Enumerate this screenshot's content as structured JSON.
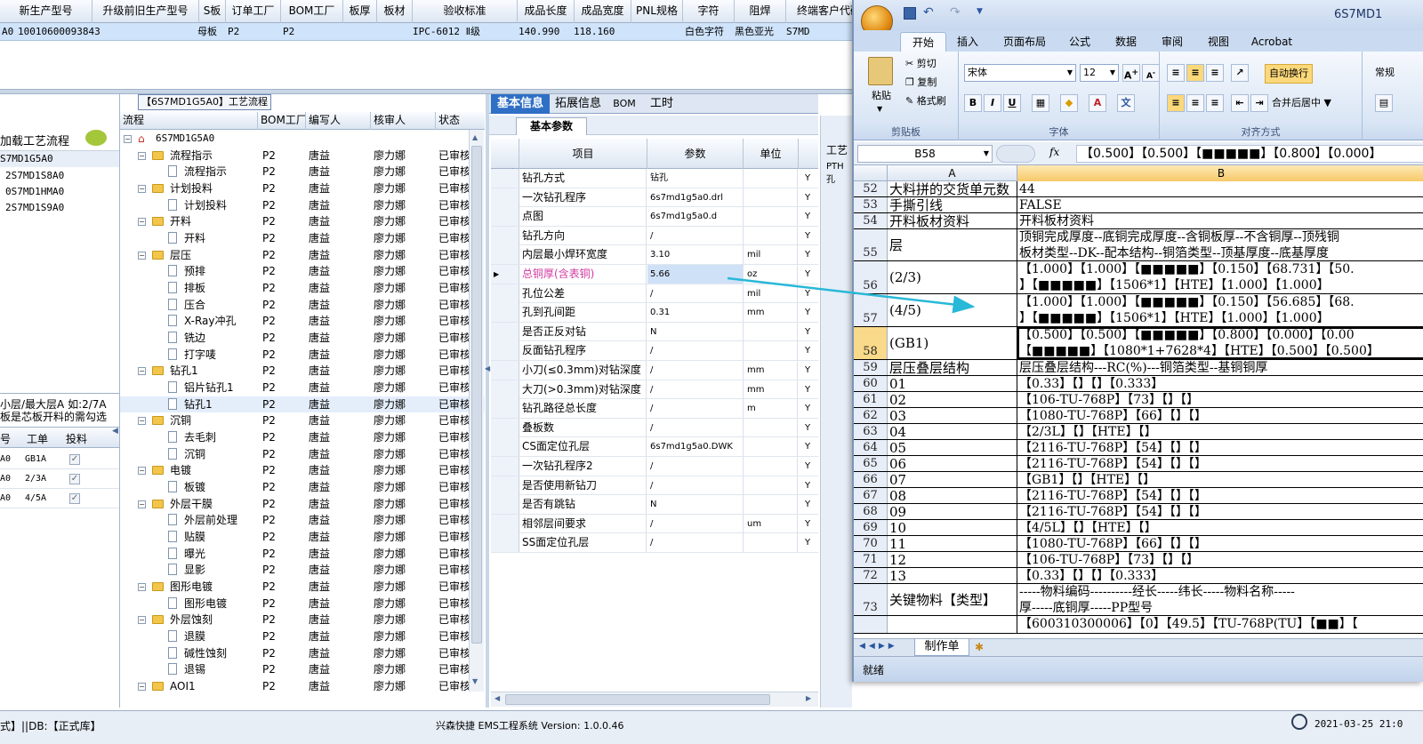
{
  "top_grid": {
    "headers": [
      "新生产型号",
      "升级前旧生产型号",
      "S板",
      "订单工厂",
      "BOM工厂",
      "板厚",
      "板材",
      "验收标准",
      "成品长度",
      "成品宽度",
      "PNL规格",
      "字符",
      "阻焊",
      "终端客户代码"
    ],
    "row": [
      "A0",
      "10010600093843",
      "",
      "母板",
      "P2",
      "P2",
      "",
      "IPC-6012 Ⅱ级",
      "140.990",
      "118.160",
      "",
      "白色字符",
      "黑色亚光",
      "S7MD"
    ]
  },
  "left_panel": {
    "title": "加载工艺流程",
    "items": [
      "S7MD1G5A0",
      "2S7MD1S8A0",
      "0S7MD1HMA0",
      "2S7MD1S9A0"
    ],
    "note_line1": "小层/最大层A 如:2/7A",
    "note_line2": "板是芯板开料的需勾选",
    "mini_headers": [
      "号",
      "工单",
      "投料"
    ],
    "mini_rows": [
      {
        "id": "A0",
        "order": "GB1A"
      },
      {
        "id": "A0",
        "order": "2/3A"
      },
      {
        "id": "A0",
        "order": "4/5A"
      }
    ]
  },
  "flow_panel": {
    "title": "【6S7MD1G5A0】工艺流程",
    "headers": [
      "流程",
      "BOM工厂",
      "编写人",
      "核审人",
      "状态"
    ],
    "root": "6S7MD1G5A0",
    "rows": [
      {
        "t": "f",
        "n": "流程指示"
      },
      {
        "t": "d",
        "n": "流程指示"
      },
      {
        "t": "f",
        "n": "计划投料"
      },
      {
        "t": "d",
        "n": "计划投料"
      },
      {
        "t": "f",
        "n": "开料"
      },
      {
        "t": "d",
        "n": "开料"
      },
      {
        "t": "f",
        "n": "层压"
      },
      {
        "t": "d",
        "n": "预排"
      },
      {
        "t": "d",
        "n": "排板"
      },
      {
        "t": "d",
        "n": "压合"
      },
      {
        "t": "d",
        "n": "X-Ray冲孔"
      },
      {
        "t": "d",
        "n": "铣边"
      },
      {
        "t": "d",
        "n": "打字唛"
      },
      {
        "t": "f",
        "n": "钻孔1"
      },
      {
        "t": "d",
        "n": "铝片钻孔1"
      },
      {
        "t": "d",
        "n": "钻孔1"
      },
      {
        "t": "f",
        "n": "沉铜"
      },
      {
        "t": "d",
        "n": "去毛刺"
      },
      {
        "t": "d",
        "n": "沉铜"
      },
      {
        "t": "f",
        "n": "电镀"
      },
      {
        "t": "d",
        "n": "板镀"
      },
      {
        "t": "f",
        "n": "外层干膜"
      },
      {
        "t": "d",
        "n": "外层前处理"
      },
      {
        "t": "d",
        "n": "贴膜"
      },
      {
        "t": "d",
        "n": "曝光"
      },
      {
        "t": "d",
        "n": "显影"
      },
      {
        "t": "f",
        "n": "图形电镀"
      },
      {
        "t": "d",
        "n": "图形电镀"
      },
      {
        "t": "f",
        "n": "外层蚀刻"
      },
      {
        "t": "d",
        "n": "退膜"
      },
      {
        "t": "d",
        "n": "碱性蚀刻"
      },
      {
        "t": "d",
        "n": "退锡"
      },
      {
        "t": "f",
        "n": "AOI1"
      }
    ],
    "bom": "P2",
    "writer": "唐益",
    "auditor": "廖力娜",
    "status": "已审核"
  },
  "params_panel": {
    "tabs": [
      "基本信息",
      "拓展信息",
      "BOM",
      "工时"
    ],
    "subtab": "基本参数",
    "headers": [
      "项目",
      "参数",
      "单位"
    ],
    "rows": [
      [
        "钻孔方式",
        "钻孔",
        "",
        "Y"
      ],
      [
        "一次钻孔程序",
        "6s7md1g5a0.drl",
        "",
        "Y"
      ],
      [
        "点图",
        "6s7md1g5a0.d",
        "",
        "Y"
      ],
      [
        "钻孔方向",
        "/",
        "",
        "Y"
      ],
      [
        "内层最小焊环宽度",
        "3.10",
        "mil",
        "Y"
      ],
      [
        "总铜厚(含表铜)",
        "5.66",
        "oz",
        "Y"
      ],
      [
        "孔位公差",
        "/",
        "mil",
        "Y"
      ],
      [
        "孔到孔间距",
        "0.31",
        "mm",
        "Y"
      ],
      [
        "是否正反对钻",
        "N",
        "",
        "Y"
      ],
      [
        "反面钻孔程序",
        "/",
        "",
        "Y"
      ],
      [
        "小刀(≤0.3mm)对钻深度",
        "/",
        "mm",
        "Y"
      ],
      [
        "大刀(>0.3mm)对钻深度",
        "/",
        "mm",
        "Y"
      ],
      [
        "钻孔路径总长度",
        "/",
        "m",
        "Y"
      ],
      [
        "叠板数",
        "/",
        "",
        "Y"
      ],
      [
        "CS面定位孔层",
        "6s7md1g5a0.DWK",
        "",
        "Y"
      ],
      [
        "一次钻孔程序2",
        "/",
        "",
        "Y"
      ],
      [
        "是否使用新钻刀",
        "/",
        "",
        "Y"
      ],
      [
        "是否有跳钻",
        "N",
        "",
        "Y"
      ],
      [
        "相邻层间要求",
        "/",
        "um",
        "Y"
      ],
      [
        "SS面定位孔层",
        "/",
        "",
        "Y"
      ]
    ],
    "highlight_index": 5
  },
  "side_tab": {
    "label1": "工艺",
    "label2": "PTH孔"
  },
  "excel": {
    "title": "6S7MD1",
    "ribbon_tabs": [
      "开始",
      "插入",
      "页面布局",
      "公式",
      "数据",
      "审阅",
      "视图",
      "Acrobat"
    ],
    "paste": "粘贴",
    "cut": "剪切",
    "copy": "复制",
    "format_painter": "格式刷",
    "clipboard_group": "剪贴板",
    "font_name": "宋体",
    "font_size": "12",
    "font_group": "字体",
    "wrap": "自动换行",
    "merge": "合并后居中",
    "align_group": "对齐方式",
    "number_fmt": "常规",
    "name_box": "B58",
    "formula": "【0.500】【0.500】【■■■■■】【0.800】【0.000】",
    "col_a": "A",
    "col_b": "B",
    "rows": [
      {
        "n": "52",
        "a": "大料拼的交货单元数",
        "b": [
          "44"
        ]
      },
      {
        "n": "53",
        "a": "手撕引线",
        "b": [
          "FALSE"
        ]
      },
      {
        "n": "54",
        "a": "开料板材资料",
        "b": [
          "开料板材资料"
        ]
      },
      {
        "n": "55",
        "a": "层",
        "b": [
          "顶铜完成厚度--底铜完成厚度--含铜板厚--不含铜厚--顶残铜",
          "板材类型--DK--配本结构--铜箔类型--顶基厚度--底基厚度"
        ]
      },
      {
        "n": "56",
        "a": "(2/3)",
        "b": [
          "【1.000】【1.000】【■■■■■】【0.150】【68.731】【50.",
          "】【■■■■■】【1506*1】【HTE】【1.000】【1.000】"
        ]
      },
      {
        "n": "57",
        "a": "(4/5)",
        "b": [
          "【1.000】【1.000】【■■■■■】【0.150】【56.685】【68.",
          "】【■■■■■】【1506*1】【HTE】【1.000】【1.000】"
        ]
      },
      {
        "n": "58",
        "a": "(GB1)",
        "b": [
          "【0.500】【0.500】【■■■■■】【0.800】【0.000】【0.00",
          "【■■■■■】【1080*1+7628*4】【HTE】【0.500】【0.500】"
        ]
      },
      {
        "n": "59",
        "a": "层压叠层结构",
        "b": [
          "层压叠层结构---RC(%)---铜箔类型--基铜铜厚"
        ]
      },
      {
        "n": "60",
        "a": "01",
        "b": [
          "【0.33】【】【】【0.333】"
        ]
      },
      {
        "n": "61",
        "a": "02",
        "b": [
          "【106-TU-768P】【73】【】【】"
        ]
      },
      {
        "n": "62",
        "a": "03",
        "b": [
          "【1080-TU-768P】【66】【】【】"
        ]
      },
      {
        "n": "63",
        "a": "04",
        "b": [
          "【2/3L】【】【HTE】【】"
        ]
      },
      {
        "n": "64",
        "a": "05",
        "b": [
          "【2116-TU-768P】【54】【】【】"
        ]
      },
      {
        "n": "65",
        "a": "06",
        "b": [
          "【2116-TU-768P】【54】【】【】"
        ]
      },
      {
        "n": "66",
        "a": "07",
        "b": [
          "【GB1】【】【HTE】【】"
        ]
      },
      {
        "n": "67",
        "a": "08",
        "b": [
          "【2116-TU-768P】【54】【】【】"
        ]
      },
      {
        "n": "68",
        "a": "09",
        "b": [
          "【2116-TU-768P】【54】【】【】"
        ]
      },
      {
        "n": "69",
        "a": "10",
        "b": [
          "【4/5L】【】【HTE】【】"
        ]
      },
      {
        "n": "70",
        "a": "11",
        "b": [
          "【1080-TU-768P】【66】【】【】"
        ]
      },
      {
        "n": "71",
        "a": "12",
        "b": [
          "【106-TU-768P】【73】【】【】"
        ]
      },
      {
        "n": "72",
        "a": "13",
        "b": [
          "【0.33】【】【】【0.333】"
        ]
      },
      {
        "n": "73",
        "a": "关键物料【类型】",
        "b": [
          "-----物料编码----------经长-----纬长-----物料名称-----",
          "厚-----底铜厚-----PP型号"
        ]
      },
      {
        "n": "",
        "a": "",
        "b": [
          "【600310300006】【0】【49.5】【TU-768P(TU】【■■】【"
        ]
      }
    ],
    "sheet_tab": "制作单",
    "status": "就绪"
  },
  "status_bar": {
    "left": "式】||DB:【正式库】",
    "center": "兴森快捷 EMS工程系统 Version: 1.0.0.46",
    "right": "2021-03-25 21:0"
  }
}
